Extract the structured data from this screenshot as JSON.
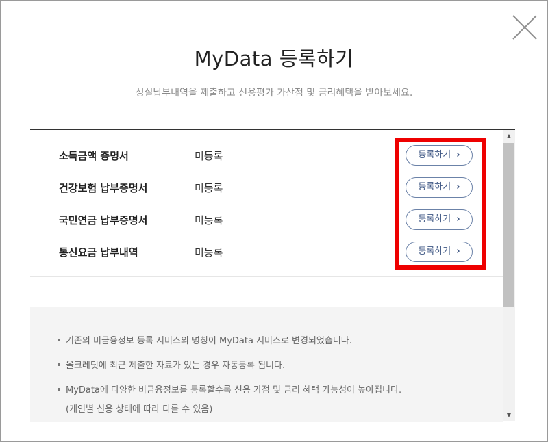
{
  "dialog": {
    "title": "MyData 등록하기",
    "subtitle": "성실납부내역을 제출하고 신용평가 가산점 및 금리혜택을 받아보세요.",
    "close_icon": "close-x-icon"
  },
  "rows": [
    {
      "name": "소득금액 증명서",
      "status": "미등록",
      "button": "등록하기"
    },
    {
      "name": "건강보험 납부증명서",
      "status": "미등록",
      "button": "등록하기"
    },
    {
      "name": "국민연금 납부증명서",
      "status": "미등록",
      "button": "등록하기"
    },
    {
      "name": "통신요금 납부내역",
      "status": "미등록",
      "button": "등록하기"
    }
  ],
  "button_chevron": "›",
  "notices": [
    "기존의 비금융정보 등록 서비스의 명칭이 MyData 서비스로 변경되었습니다.",
    "올크레딧에 최근 제출한 자료가 있는 경우 자동등록 됩니다.",
    "MyData에 다양한 비금융정보를 등록할수록 신용 가점 및 금리 혜택 가능성이 높아집니다."
  ],
  "notice_sub": "(개인별 신용 상태에 따라 다를 수 있음)",
  "scrollbar": {
    "up": "▲",
    "down": "▼"
  },
  "colors": {
    "highlight": "#ee0000",
    "button_border": "#6b82a8",
    "button_text": "#3d5683",
    "notice_bg": "#f4f4f4"
  }
}
